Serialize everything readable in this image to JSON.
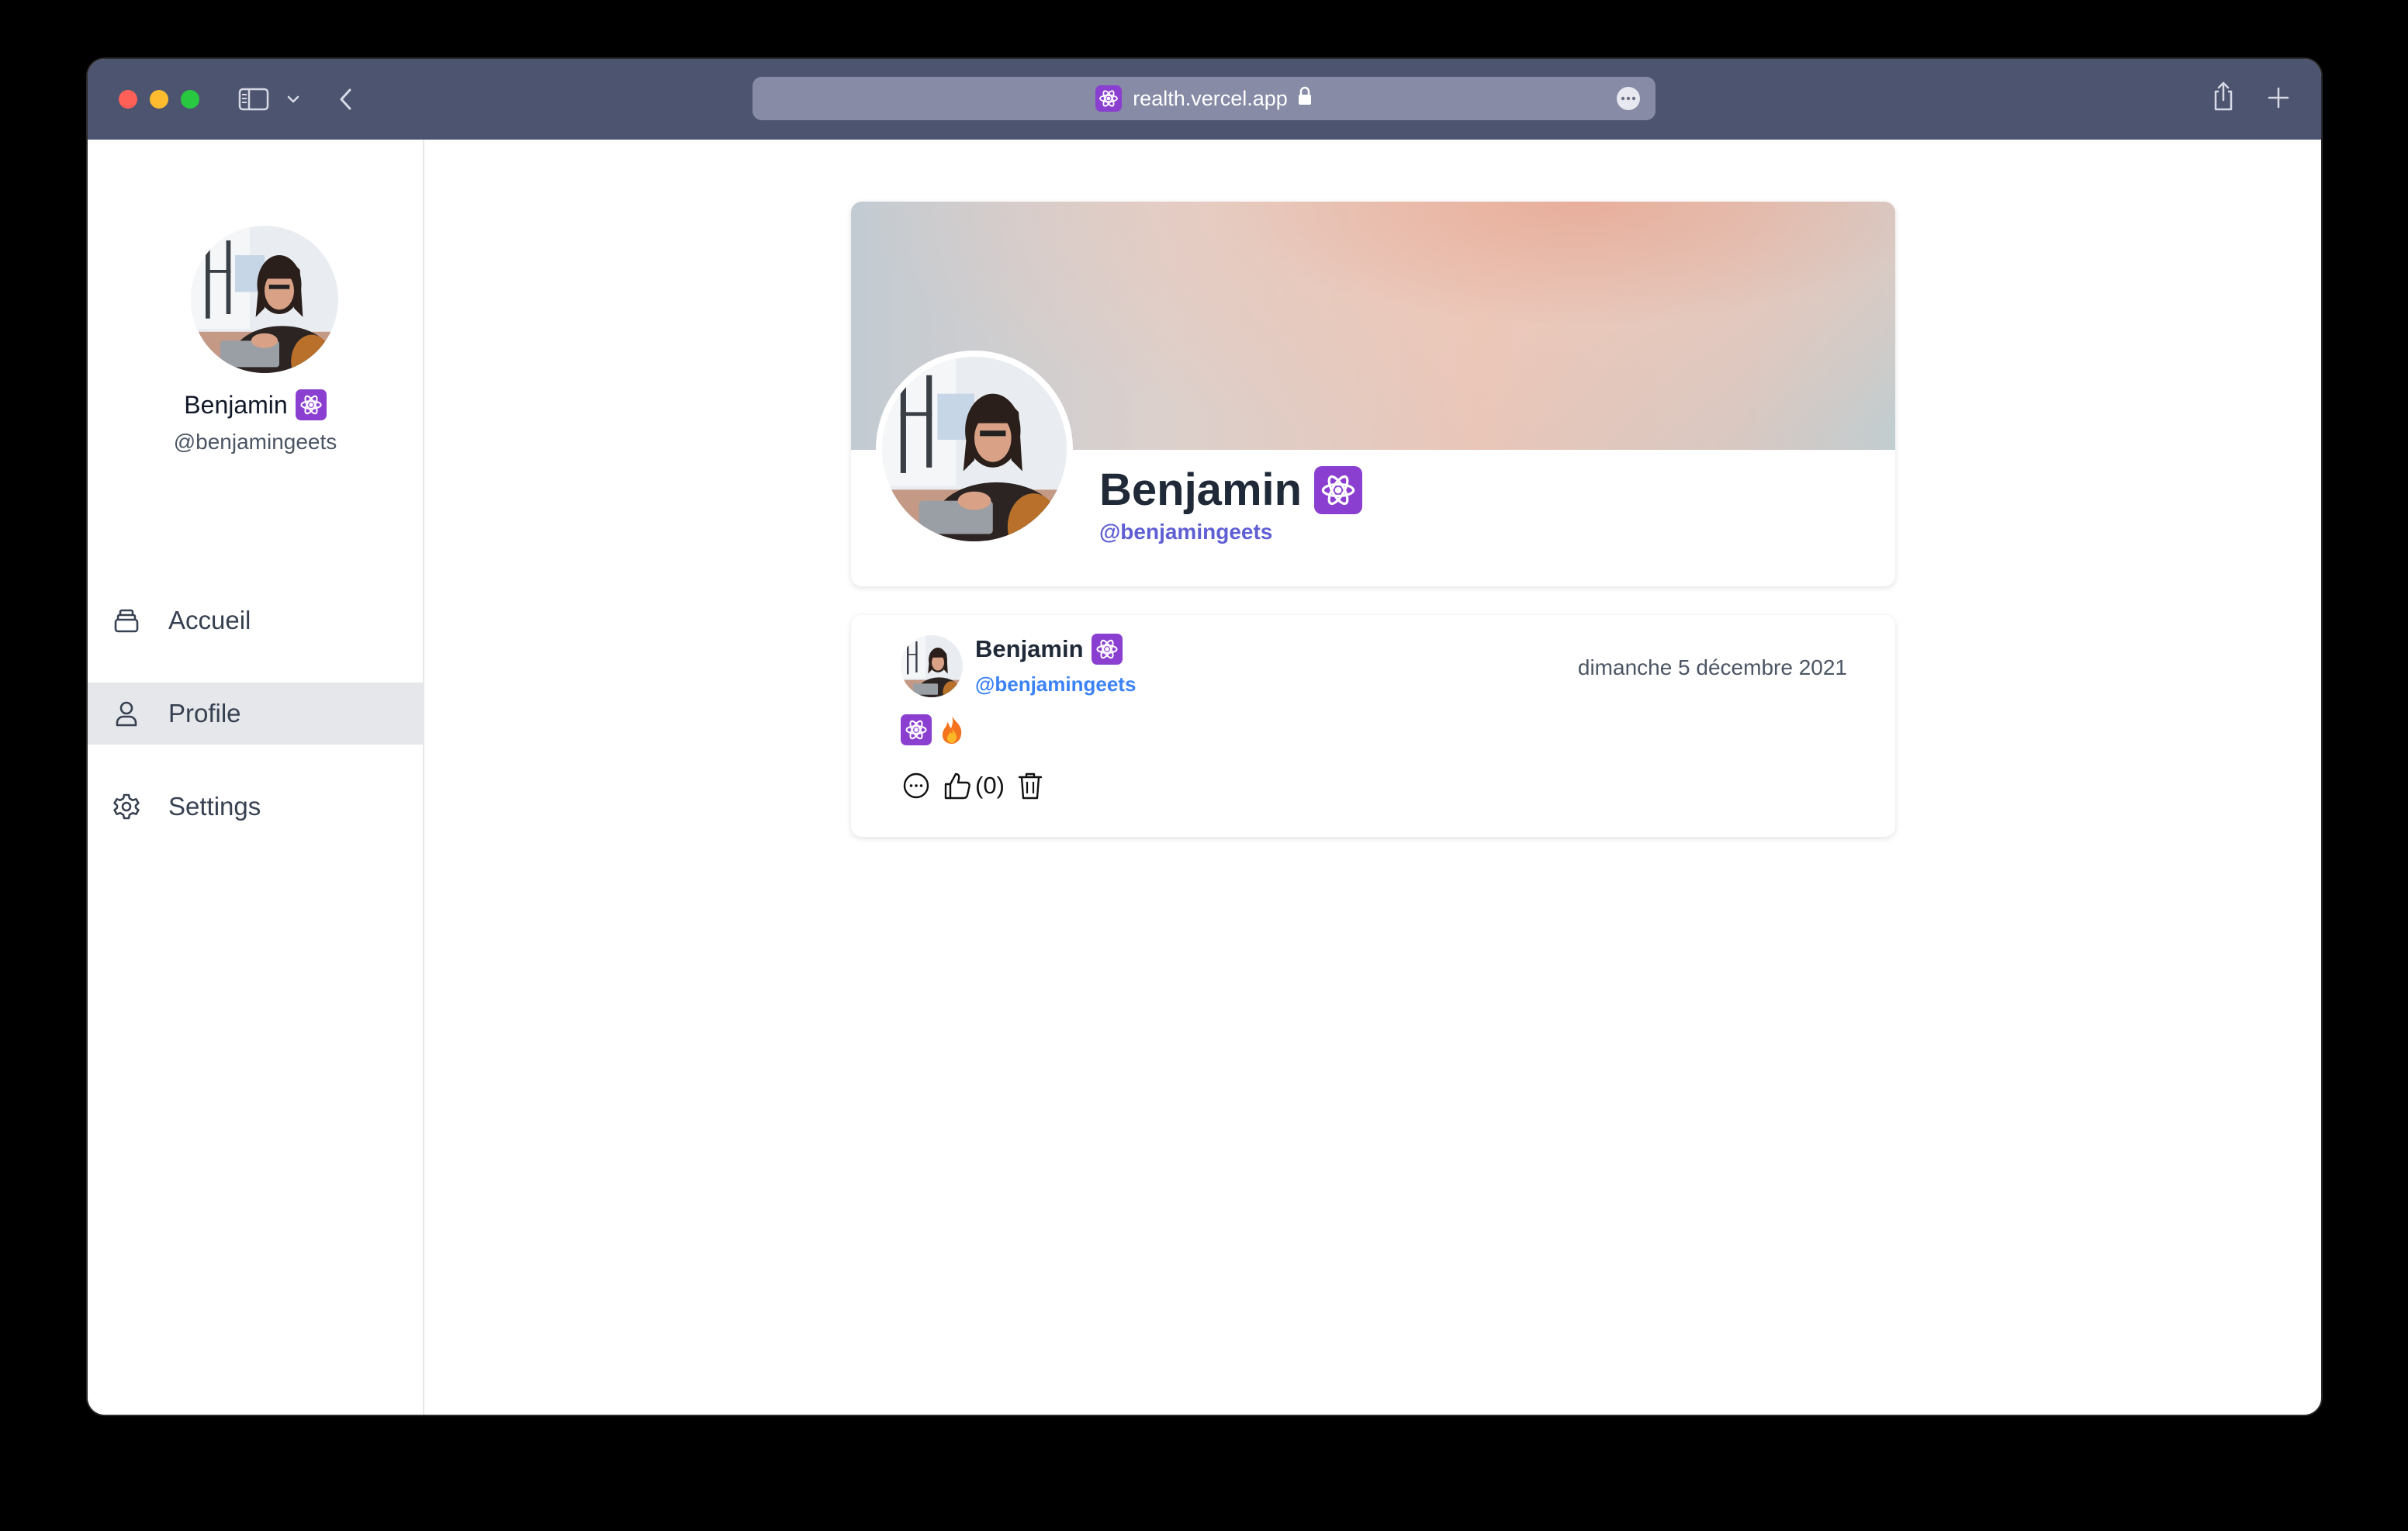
{
  "browser": {
    "url": "realth.vercel.app",
    "favicon": "atom-icon",
    "colors": {
      "titlebar": "#4d546f",
      "urlbar": "#878ba6"
    }
  },
  "sidebar": {
    "user": {
      "name": "Benjamin",
      "badge": "atom-icon",
      "handle": "@benjamingeets"
    },
    "items": [
      {
        "label": "Accueil",
        "icon": "stack-icon",
        "active": false
      },
      {
        "label": "Profile",
        "icon": "user-icon",
        "active": true
      },
      {
        "label": "Settings",
        "icon": "gear-icon",
        "active": false
      }
    ]
  },
  "profile": {
    "name": "Benjamin",
    "badge": "atom-icon",
    "handle": "@benjamingeets"
  },
  "post": {
    "author": "Benjamin",
    "handle": "@benjamingeets",
    "date": "dimanche 5 décembre 2021",
    "content_icons": [
      "atom-icon",
      "fire-icon"
    ],
    "likes": "(0)"
  },
  "colors": {
    "accent_purple": "#8b3fd0",
    "handle_indigo": "#5f5fd4",
    "handle_blue": "#3b82f6",
    "nav_active_bg": "#e5e7eb"
  }
}
